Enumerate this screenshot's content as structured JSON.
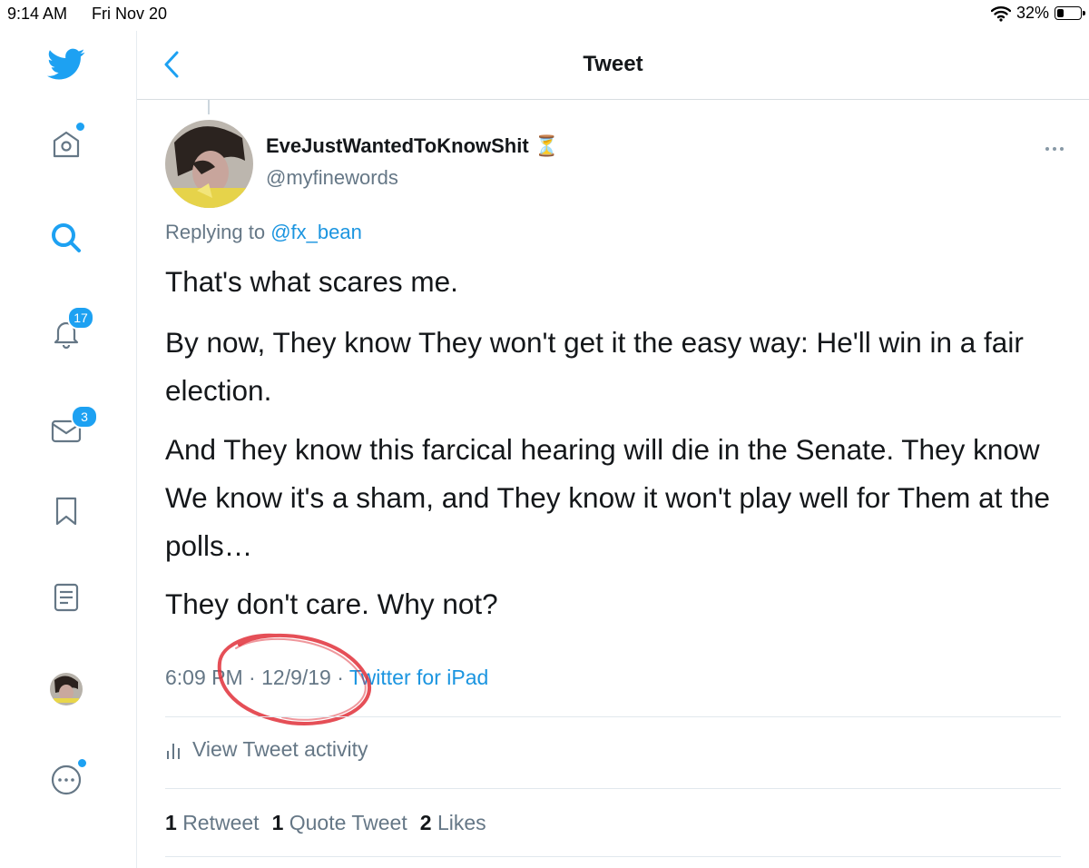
{
  "status_bar": {
    "time": "9:14 AM",
    "date": "Fri Nov 20",
    "battery": "32%",
    "battery_level": 0.32
  },
  "sidebar": {
    "items": [
      {
        "icon": "twitter-bird-icon"
      },
      {
        "icon": "home-icon",
        "has_dot": true
      },
      {
        "icon": "search-icon"
      },
      {
        "icon": "bell-icon",
        "badge": "17"
      },
      {
        "icon": "mail-icon",
        "badge": "3"
      },
      {
        "icon": "bookmark-icon"
      },
      {
        "icon": "list-icon"
      },
      {
        "icon": "profile-avatar"
      },
      {
        "icon": "more-icon",
        "has_dot": true
      }
    ]
  },
  "header": {
    "title": "Tweet"
  },
  "tweet": {
    "display_name": "EveJustWantedToKnowShit",
    "name_emoji": "⏳",
    "handle": "@myfinewords",
    "replying_prefix": "Replying to",
    "replying_to": "@fx_bean",
    "paragraphs": [
      "That's what scares me.",
      "By now, They know They won't get it the easy way: He'll win in a fair election.",
      "And They know this farcical hearing will die in the Senate. They know We know it's a sham, and They know it won't play well for Them at the polls…",
      "They don't care. Why not?"
    ],
    "time": "6:09 PM",
    "date": "12/9/19",
    "separator": "·",
    "source": "Twitter for iPad",
    "activity_label": "View Tweet activity",
    "stats": {
      "retweets_count": "1",
      "retweets_label": "Retweet",
      "quotes_count": "1",
      "quotes_label": "Quote Tweet",
      "likes_count": "2",
      "likes_label": "Likes"
    }
  },
  "colors": {
    "accent": "#1da1f2",
    "link": "#1b95e0",
    "secondary_text": "#657786",
    "annotation": "#e0303a"
  }
}
